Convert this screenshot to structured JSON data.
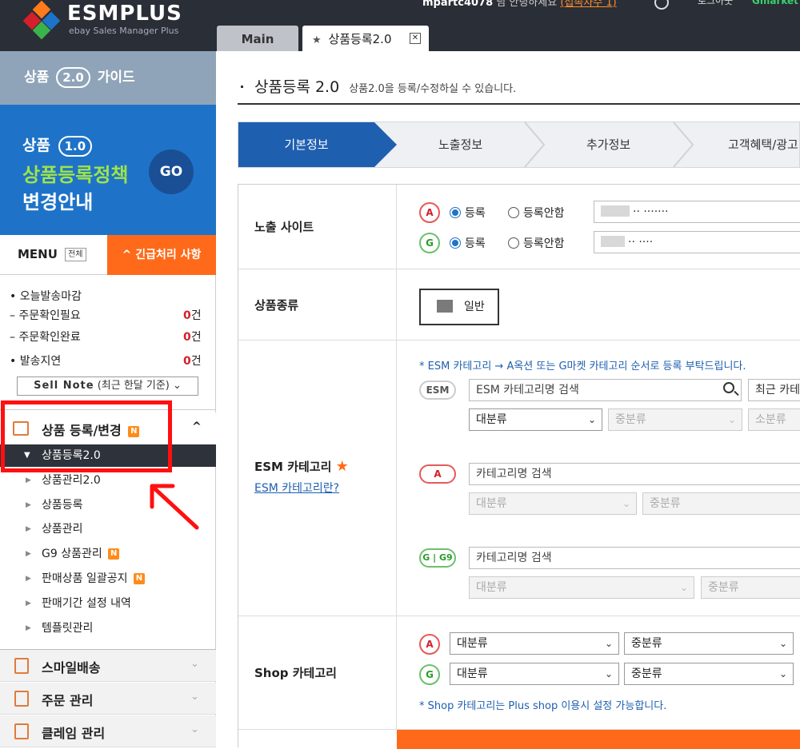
{
  "header": {
    "logo_name": "ESMPLUS",
    "logo_sub": "ebay Sales Manager Plus",
    "user_id": "mpartc4078",
    "user_greeting": "님 안녕하세요",
    "user_link": "(접속자수 1)",
    "top_link": "로그아웃",
    "gmarket": "Gmarket",
    "colors": {
      "bar": "#2a2e36",
      "accent": "#ff6a1a",
      "primary": "#1e73c8"
    }
  },
  "tabs": {
    "main": "Main",
    "product_reg": "상품등록2.0",
    "close_icon": "close-icon"
  },
  "sidebar": {
    "guide": {
      "pre": "상품",
      "ver": "2.0",
      "post": "가이드"
    },
    "banner": {
      "l1_pre": "상품",
      "l1_ver": "1.0",
      "l2": "상품등록정책",
      "l3": "변경안내",
      "go": "GO"
    },
    "menu_label": "MENU",
    "menu_all": "전체",
    "urgent": "^ 긴급처리 사항",
    "stats": [
      {
        "label": "• 오늘발송마감",
        "value": ""
      },
      {
        "label": "  – 주문확인필요",
        "value": "0",
        "unit": "건"
      },
      {
        "label": "  – 주문확인완료",
        "value": "0",
        "unit": "건"
      },
      {
        "label": "• 발송지연",
        "value": "0",
        "unit": "건"
      }
    ],
    "sellnote": {
      "bold": "Sell Note",
      "rest": " (최근 한달 기준) ⌄"
    },
    "section_title": "상품 등록/변경",
    "badge_n": "N",
    "active_sub": "상품등록2.0",
    "subitems": [
      "상품관리2.0",
      "상품등록",
      "상품관리",
      "G9 상품관리",
      "판매상품 일괄공지",
      "판매기간 설정 내역",
      "템플릿관리"
    ],
    "categories": [
      "스마일배송",
      "주문 관리",
      "클레임 관리"
    ]
  },
  "content": {
    "title": "상품등록 2.0",
    "desc": "상품2.0을 등록/수정하실 수 있습니다.",
    "steps": [
      "기본정보",
      "노출정보",
      "추가정보",
      "고객혜택/광고"
    ],
    "rows": {
      "site": {
        "label": "노출 사이트",
        "badge_a": "A",
        "badge_g": "G",
        "opt_yes": "등록",
        "opt_no": "등록안함",
        "a_id": "·· ·······",
        "g_id": "·· ····"
      },
      "type": {
        "label": "상품종류",
        "value": "일반"
      },
      "esm": {
        "label": "ESM 카테고리",
        "help_link": "ESM 카테고리란?",
        "notice": "* ESM 카테고리 → A옥션 또는 G마켓 카테고리 순서로 등록 부탁드립니다.",
        "esm_badge": "ESM",
        "esm_placeholder": "ESM 카테고리명 검색",
        "recent": "최근 카테",
        "a_badge": "A",
        "g_badge": "G | G9",
        "cat_placeholder": "카테고리명 검색",
        "big": "대분류",
        "mid": "중분류",
        "small": "소분류"
      },
      "shop": {
        "label": "Shop 카테고리",
        "badge_a": "A",
        "badge_g": "G",
        "big": "대분류",
        "mid": "중분류",
        "note": "* Shop 카테고리는 Plus shop 이용시 설정 가능합니다."
      }
    }
  }
}
